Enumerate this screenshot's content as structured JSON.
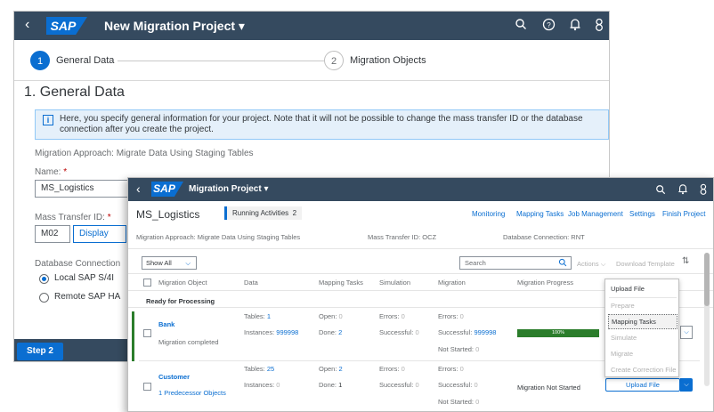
{
  "back_window": {
    "title": "New Migration Project ▾",
    "logo": "SAP",
    "back_icon": "‹",
    "shell_icons": [
      "search-icon",
      "help-icon",
      "bell-icon",
      "user-icon"
    ],
    "wizard": {
      "steps": [
        {
          "number": "1",
          "label": "General Data"
        },
        {
          "number": "2",
          "label": "Migration Objects"
        }
      ]
    },
    "section_title": "1. General Data",
    "info_text": "Here, you specify general information for your project. Note that it will not be possible to change the mass transfer ID or the database connection after you create the project.",
    "approach": "Migration Approach: Migrate Data Using Staging Tables",
    "name_label": "Name:",
    "name_required": "*",
    "name_value": "MS_Logistics",
    "mass_transfer_label": "Mass Transfer ID:",
    "mass_transfer_required": "*",
    "mass_transfer_value": "M02",
    "display_label": "Display",
    "db_connection_label": "Database Connection",
    "radio_local": "Local SAP S/4I",
    "radio_remote": "Remote SAP HA",
    "footer_button": "Step 2"
  },
  "front_window": {
    "title": "Migration Project ▾",
    "logo": "SAP",
    "back_icon": "‹",
    "project_name": "MS_Logistics",
    "running_label": "Running Activities",
    "running_count": "2",
    "top_links": [
      "Monitoring",
      "Mapping Tasks",
      "Job Management",
      "Settings",
      "Finish Project"
    ],
    "approach": "Migration Approach: Migrate Data Using Staging Tables",
    "mass_transfer": "Mass Transfer ID: OCZ",
    "db_connection": "Database Connection: RNT",
    "filter_value": "Show All",
    "search_placeholder": "Search",
    "actions_label": "Actions",
    "download_label": "Download Template",
    "columns": [
      "Migration Object",
      "Data",
      "Mapping Tasks",
      "Simulation",
      "Migration",
      "Migration Progress"
    ],
    "group_label": "Ready for Processing",
    "rows": [
      {
        "object": "Bank",
        "subtitle": "Migration completed",
        "tables_label": "Tables:",
        "tables": "1",
        "instances_label": "Instances:",
        "instances": "999998",
        "open_label": "Open:",
        "open": "0",
        "done_label": "Done:",
        "done": "2",
        "errors_label": "Errors:",
        "errors": "0",
        "successful_label": "Successful:",
        "successful": "0",
        "mig_errors_label": "Errors:",
        "mig_errors": "0",
        "mig_successful_label": "Successful:",
        "mig_successful": "999998",
        "not_started_label": "Not Started:",
        "not_started": "0",
        "progress_percent": 100,
        "progress_label": "100%"
      },
      {
        "object": "Customer",
        "subtitle": "1 Predecessor Objects",
        "tables_label": "Tables:",
        "tables": "25",
        "instances_label": "Instances:",
        "instances": "0",
        "open_label": "Open:",
        "open": "2",
        "done_label": "Done:",
        "done": "1",
        "errors_label": "Errors:",
        "errors": "0",
        "successful_label": "Successful:",
        "successful": "0",
        "mig_errors_label": "Errors:",
        "mig_errors": "0",
        "mig_successful_label": "Successful:",
        "mig_successful": "0",
        "not_started_label": "Not Started:",
        "not_started": "0",
        "progress_text": "Migration Not Started"
      }
    ],
    "upload_button": "Upload File",
    "menu_items": [
      "Upload File",
      "Prepare",
      "Mapping Tasks",
      "Simulate",
      "Migrate",
      "Create Correction File"
    ]
  }
}
